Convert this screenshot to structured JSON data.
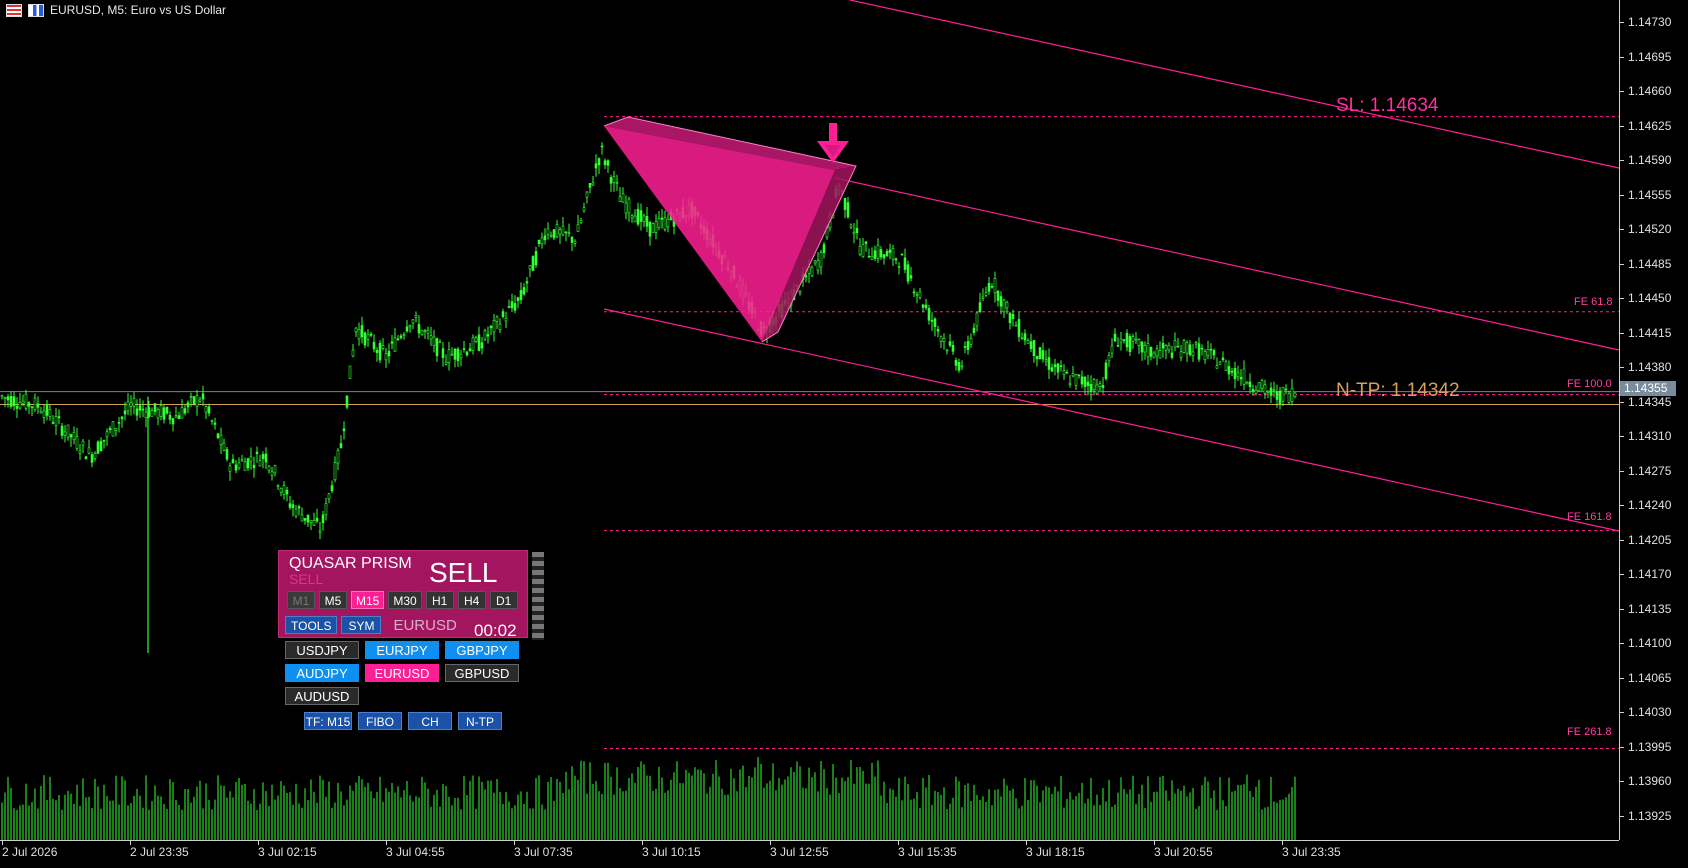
{
  "window": {
    "title": "EURUSD, M5:  Euro vs US Dollar"
  },
  "price_axis": {
    "labels": [
      "1.14730",
      "1.14695",
      "1.14660",
      "1.14625",
      "1.14590",
      "1.14555",
      "1.14520",
      "1.14485",
      "1.14450",
      "1.14415",
      "1.14380",
      "1.14345",
      "1.14310",
      "1.14275",
      "1.14240",
      "1.14205",
      "1.14170",
      "1.14135",
      "1.14100",
      "1.14065",
      "1.14030",
      "1.13995",
      "1.13960",
      "1.13925"
    ],
    "current_price": "1.14355"
  },
  "time_axis": {
    "labels": [
      "2 Jul 2026",
      "2 Jul 23:35",
      "3 Jul 02:15",
      "3 Jul 04:55",
      "3 Jul 07:35",
      "3 Jul 10:15",
      "3 Jul 12:55",
      "3 Jul 15:35",
      "3 Jul 18:15",
      "3 Jul 20:55",
      "3 Jul 23:35"
    ]
  },
  "levels": {
    "sl": "SL: 1.14634",
    "ntp": "N-TP: 1.14342",
    "fe618": "FE 61.8",
    "fe100": "FE 100.0",
    "fe1618": "FE 161.8",
    "fe2618": "FE 261.8"
  },
  "colors": {
    "candles": "#33ff33",
    "accent": "#ff1f95",
    "ntp": "#d6a05a",
    "panel": "#a3155e"
  },
  "panel": {
    "name": "QUASAR PRISM",
    "sub_signal": "SELL",
    "signal": "SELL",
    "timeframes": [
      {
        "label": "M1",
        "state": "off"
      },
      {
        "label": "M5",
        "state": "normal"
      },
      {
        "label": "M15",
        "state": "on"
      },
      {
        "label": "M30",
        "state": "normal"
      },
      {
        "label": "H1",
        "state": "normal"
      },
      {
        "label": "H4",
        "state": "normal"
      },
      {
        "label": "D1",
        "state": "normal"
      }
    ],
    "tools_label": "TOOLS",
    "sym_label": "SYM",
    "symbol": "EURUSD",
    "timer": "00:02"
  },
  "symbols": [
    {
      "label": "USDJPY",
      "style": "dark"
    },
    {
      "label": "EURJPY",
      "style": "blue"
    },
    {
      "label": "GBPJPY",
      "style": "blue"
    },
    {
      "label": "AUDJPY",
      "style": "blue"
    },
    {
      "label": "EURUSD",
      "style": "pink"
    },
    {
      "label": "GBPUSD",
      "style": "dark"
    },
    {
      "label": "AUDUSD",
      "style": "dark"
    }
  ],
  "tool_buttons": [
    "TF: M15",
    "FIBO",
    "CH",
    "N-TP"
  ]
}
